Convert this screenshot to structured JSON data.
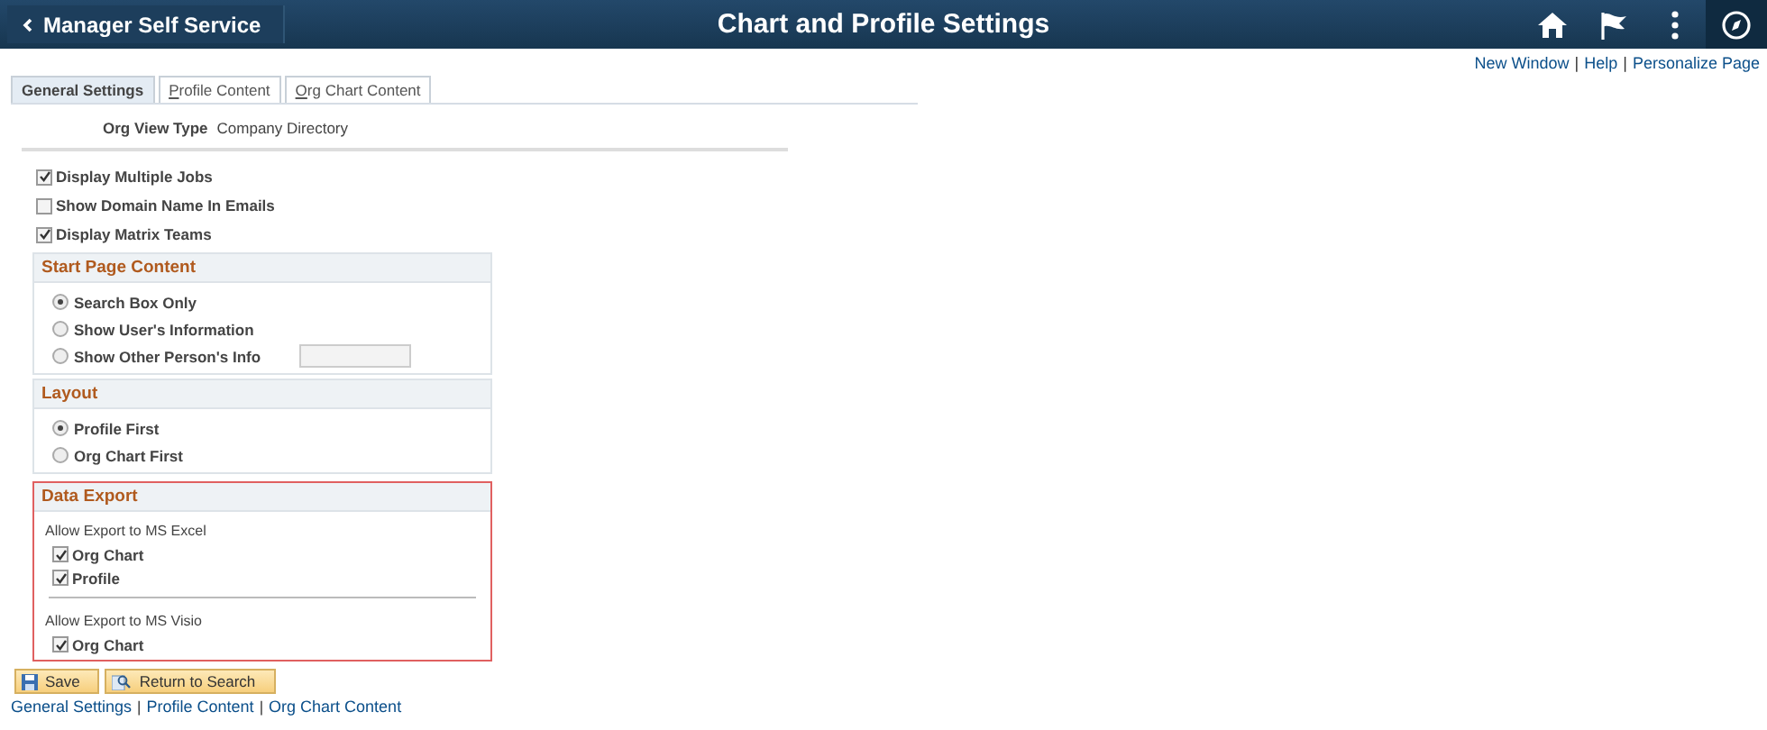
{
  "header": {
    "back_label": "Manager Self Service",
    "title": "Chart and Profile Settings"
  },
  "top_links": {
    "separator": "|",
    "items": [
      "New Window",
      "Help",
      "Personalize Page"
    ]
  },
  "tabs": [
    {
      "label": "General Settings",
      "selected": true
    },
    {
      "label": "Profile Content",
      "selected": false
    },
    {
      "label": "Org Chart Content",
      "selected": false
    }
  ],
  "org_view_type": {
    "label": "Org View Type",
    "value": "Company Directory"
  },
  "options": [
    {
      "label": "Display Multiple Jobs",
      "checked": true
    },
    {
      "label": "Show Domain Name In Emails",
      "checked": false
    },
    {
      "label": "Display Matrix Teams",
      "checked": true
    }
  ],
  "start_page_content": {
    "title": "Start Page Content",
    "choices": [
      {
        "label": "Search Box Only",
        "selected": true,
        "has_field": false
      },
      {
        "label": "Show User's Information",
        "selected": false,
        "has_field": false
      },
      {
        "label": "Show Other Person's Info",
        "selected": false,
        "has_field": true
      }
    ]
  },
  "layout": {
    "title": "Layout",
    "choices": [
      {
        "label": "Profile First",
        "selected": true
      },
      {
        "label": "Org Chart First",
        "selected": false
      }
    ]
  },
  "data_export": {
    "title": "Data Export",
    "highlighted": true,
    "groups": [
      {
        "label": "Allow Export to MS Excel",
        "items": [
          {
            "label": "Org Chart",
            "checked": true
          },
          {
            "label": "Profile",
            "checked": true
          }
        ]
      },
      {
        "label": "Allow Export to MS Visio",
        "items": [
          {
            "label": "Org Chart",
            "checked": true
          }
        ]
      }
    ]
  },
  "buttons": [
    {
      "label": "Save",
      "kind": "save"
    },
    {
      "label": "Return to Search",
      "kind": "search"
    }
  ],
  "bottom_links": {
    "separator": "|",
    "items": [
      "General Settings",
      "Profile Content",
      "Org Chart Content"
    ]
  }
}
